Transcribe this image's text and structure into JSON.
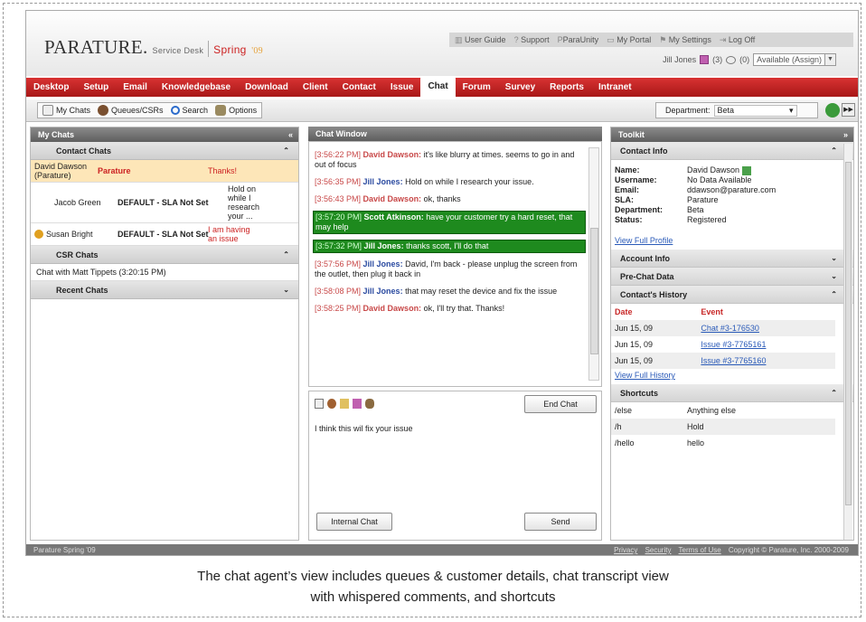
{
  "header": {
    "logo": "PARATURE.",
    "product": "Service Desk",
    "edition": "Spring",
    "edition_year": "'09",
    "links": [
      "User Guide",
      "Support",
      "ParaUnity",
      "My Portal",
      "My Settings",
      "Log Off"
    ],
    "user": "Jill Jones",
    "count_a": "(3)",
    "count_b": "(0)",
    "status": "Available (Assign)"
  },
  "tabs": [
    "Desktop",
    "Setup",
    "Email",
    "Knowledgebase",
    "Download",
    "Client",
    "Contact",
    "Issue",
    "Chat",
    "Forum",
    "Survey",
    "Reports",
    "Intranet"
  ],
  "active_tab": "Chat",
  "toolbar": {
    "my_chats": "My Chats",
    "queues": "Queues/CSRs",
    "search": "Search",
    "options": "Options",
    "dept_label": "Department:",
    "dept_value": "Beta"
  },
  "left": {
    "title": "My Chats",
    "collapse": "«",
    "contact_chats": "Contact Chats",
    "chats": [
      {
        "name": "David Dawson (Parature)",
        "dept": "Parature",
        "msg": "Thanks!"
      },
      {
        "name": "Jacob Green",
        "dept": "DEFAULT - SLA Not Set",
        "msg": "Hold on while I research your ..."
      },
      {
        "name": "Susan Bright",
        "dept": "DEFAULT - SLA Not Set",
        "msg": "I am having an issue"
      }
    ],
    "csr_chats": "CSR Chats",
    "csr_item": "Chat with Matt Tippets (3:20:15 PM)",
    "recent_chats": "Recent Chats"
  },
  "chat": {
    "title": "Chat Window",
    "messages": [
      {
        "ts": "[3:56:22 PM]",
        "who": "David Dawson:",
        "text": " it's like blurry at times. seems to go in and out of focus",
        "kind": "cust"
      },
      {
        "ts": "[3:56:35 PM]",
        "who": "Jill Jones:",
        "text": " Hold on while I research your issue.",
        "kind": "agent"
      },
      {
        "ts": "[3:56:43 PM]",
        "who": "David Dawson:",
        "text": " ok, thanks",
        "kind": "cust"
      },
      {
        "ts": "[3:57:20 PM]",
        "who": "Scott Atkinson:",
        "text": " have your customer try a hard reset, that may help",
        "kind": "whisper"
      },
      {
        "ts": "[3:57:32 PM]",
        "who": "Jill Jones:",
        "text": " thanks scott, I'll do that",
        "kind": "whisper"
      },
      {
        "ts": "[3:57:56 PM]",
        "who": "Jill Jones:",
        "text": " David, I'm back - please unplug the screen from the outlet, then plug it back in",
        "kind": "agent"
      },
      {
        "ts": "[3:58:08 PM]",
        "who": "Jill Jones:",
        "text": " that may reset the device and fix the issue",
        "kind": "agent"
      },
      {
        "ts": "[3:58:25 PM]",
        "who": "David Dawson:",
        "text": " ok, I'll try that. Thanks!",
        "kind": "cust"
      }
    ],
    "end_chat": "End Chat",
    "draft": "I think this wil fix your issue",
    "internal_chat": "Internal Chat",
    "send": "Send"
  },
  "toolkit": {
    "title": "Toolkit",
    "expand": "»",
    "contact_info": "Contact Info",
    "fields": [
      {
        "k": "Name:",
        "v": "David Dawson"
      },
      {
        "k": "Username:",
        "v": "No Data Available"
      },
      {
        "k": "Email:",
        "v": "ddawson@parature.com"
      },
      {
        "k": "SLA:",
        "v": "Parature"
      },
      {
        "k": "Department:",
        "v": "Beta"
      },
      {
        "k": "Status:",
        "v": "Registered"
      }
    ],
    "view_profile": "View Full Profile",
    "account_info": "Account Info",
    "prechat": "Pre-Chat Data",
    "history_title": "Contact's History",
    "history_headers": [
      "Date",
      "Event"
    ],
    "history": [
      {
        "date": "Jun 15, 09",
        "event": "Chat #3-176530"
      },
      {
        "date": "Jun 15, 09",
        "event": "Issue #3-7765161"
      },
      {
        "date": "Jun 15, 09",
        "event": "Issue #3-7765160"
      }
    ],
    "view_history": "View Full History",
    "shortcuts_title": "Shortcuts",
    "shortcuts": [
      {
        "k": "/else",
        "v": "Anything else"
      },
      {
        "k": "/h",
        "v": "Hold"
      },
      {
        "k": "/hello",
        "v": "hello"
      }
    ]
  },
  "footer": {
    "left": "Parature Spring '09",
    "privacy": "Privacy",
    "security": "Security",
    "terms": "Terms of Use",
    "copyright": "Copyright © Parature, Inc. 2000-2009"
  },
  "caption": {
    "line1": "The chat agent’s view includes queues & customer details, chat transcript view",
    "line2": "with whispered comments, and shortcuts"
  }
}
